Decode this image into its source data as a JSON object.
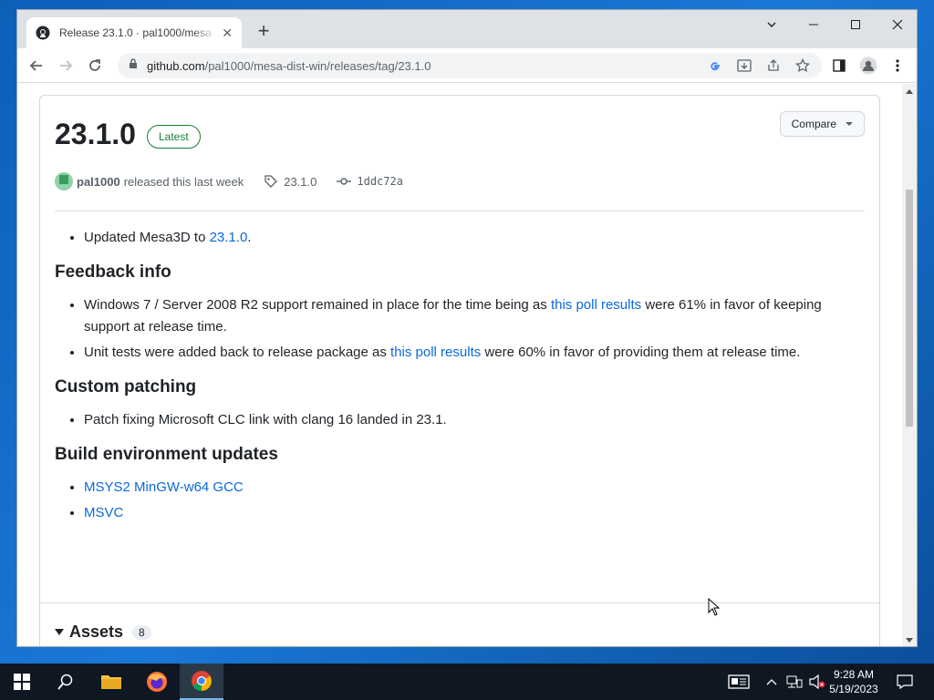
{
  "browser": {
    "tab_title": "Release 23.1.0 · pal1000/mesa-dist-win",
    "url_host": "github.com",
    "url_path": "/pal1000/mesa-dist-win/releases/tag/23.1.0"
  },
  "release": {
    "version": "23.1.0",
    "latest_label": "Latest",
    "compare_label": "Compare",
    "author": "pal1000",
    "released_text": "released this last week",
    "tag": "23.1.0",
    "commit": "1ddc72a"
  },
  "notes": {
    "item1_pre": "Updated Mesa3D to ",
    "item1_link": "23.1.0",
    "item1_post": ".",
    "h_feedback": "Feedback info",
    "fb1_pre": "Windows 7 / Server 2008 R2 support remained in place for the time being as ",
    "fb1_link": "this poll results",
    "fb1_post": " were 61% in favor of keeping support at release time.",
    "fb2_pre": "Unit tests were added back to release package as ",
    "fb2_link": "this poll results",
    "fb2_post": " were 60% in favor of providing them at release time.",
    "h_patching": "Custom patching",
    "cp1": "Patch fixing Microsoft CLC link with clang 16 landed in 23.1.",
    "h_build": "Build environment updates",
    "be1": "MSYS2 MinGW-w64 GCC",
    "be2": "MSVC"
  },
  "assets": {
    "label": "Assets",
    "count": "8"
  },
  "taskbar": {
    "time": "9:28 AM",
    "date": "5/19/2023"
  },
  "colors": {
    "link": "#0969da",
    "latest": "#1a7f37",
    "taskbar": "#0e1722"
  }
}
